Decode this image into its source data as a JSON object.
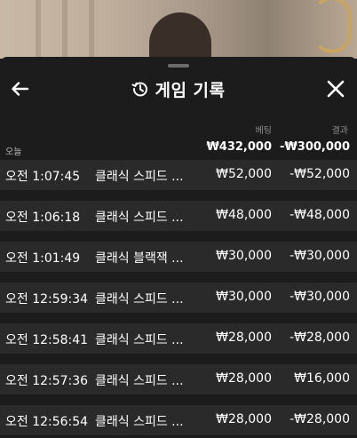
{
  "header": {
    "title": "게임 기록",
    "back_icon": "arrow-left-icon",
    "history_icon": "history-icon",
    "close_icon": "close-icon"
  },
  "columns": {
    "bet": "베팅",
    "result": "결과"
  },
  "summary": {
    "day_label": "오늘",
    "total_bet": "₩432,000",
    "total_result": "-₩300,000"
  },
  "rows": [
    {
      "time": "오전 1:07:45",
      "game": "클래식 스피드 ...",
      "bet": "₩52,000",
      "result": "-₩52,000"
    },
    {
      "time": "오전 1:06:18",
      "game": "클래식 스피드 ...",
      "bet": "₩48,000",
      "result": "-₩48,000"
    },
    {
      "time": "오전 1:01:49",
      "game": "클래식 블랙잭 ...",
      "bet": "₩30,000",
      "result": "-₩30,000"
    },
    {
      "time": "오전 12:59:34",
      "game": "클래식 스피드 ...",
      "bet": "₩30,000",
      "result": "-₩30,000"
    },
    {
      "time": "오전 12:58:41",
      "game": "클래식 스피드 ...",
      "bet": "₩28,000",
      "result": "-₩28,000"
    },
    {
      "time": "오전 12:57:36",
      "game": "클래식 스피드 ...",
      "bet": "₩28,000",
      "result": "₩16,000"
    },
    {
      "time": "오전 12:56:54",
      "game": "클래식 스피드 ...",
      "bet": "₩28,000",
      "result": "-₩28,000"
    }
  ]
}
